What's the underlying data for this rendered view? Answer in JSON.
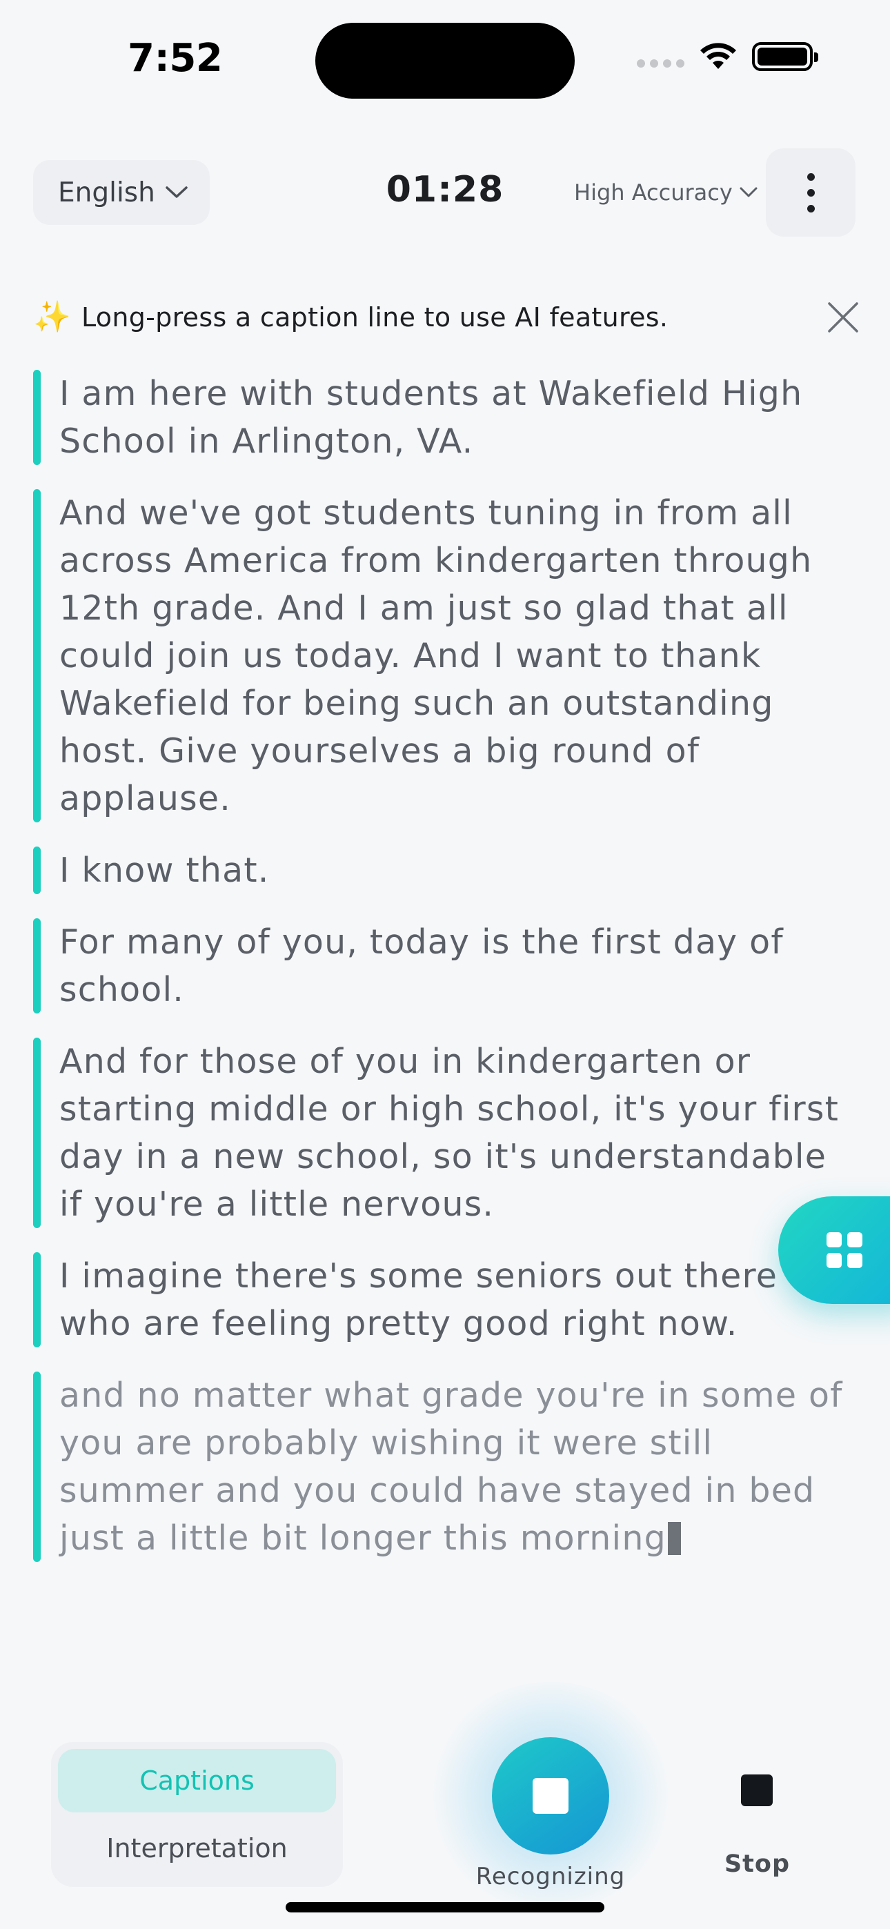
{
  "status_bar": {
    "time": "7:52"
  },
  "header": {
    "language": "English",
    "timer": "01:28",
    "accuracy": "High Accuracy"
  },
  "tip": {
    "icon": "sparkles-icon",
    "text": "Long-press a caption line to use AI features."
  },
  "captions": [
    "I am here with students at Wakefield High School in Arlington, VA.",
    "And we've got students tuning in from all across America from kindergarten through 12th grade. And I am just so glad that all could join us today. And I want to thank Wakefield for being such an outstanding host. Give yourselves a big round of applause.",
    "I know that.",
    "For many of you, today is the first day of school.",
    "And for those of you in kindergarten or starting middle or high school, it's your first day in a new school, so it's understandable if you're a little nervous.",
    "I imagine there's some seniors out there who are feeling pretty good right now."
  ],
  "live_caption": "and no matter what grade you're in some of you are probably wishing it were still summer and you could have stayed in bed just a little bit longer this morning",
  "bottom_bar": {
    "mode_captions": "Captions",
    "mode_interpretation": "Interpretation",
    "record_label": "Recognizing",
    "stop_label": "Stop"
  },
  "colors": {
    "accent": "#1ccfbf",
    "record_gradient_start": "#1fc9c9",
    "record_gradient_end": "#1596d4"
  }
}
